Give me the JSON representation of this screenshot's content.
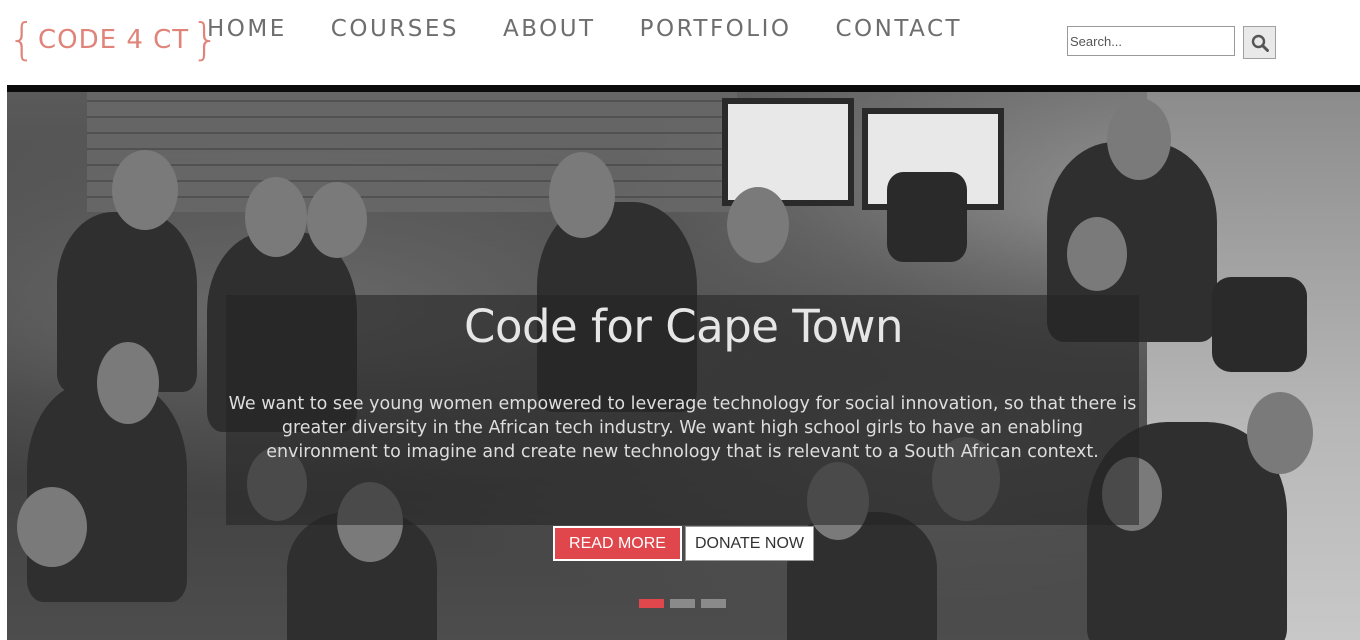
{
  "header": {
    "logo": {
      "text": "CODE 4 CT",
      "color": "#e0847a"
    },
    "nav": [
      "HOME",
      "COURSES",
      "ABOUT",
      "PORTFOLIO",
      "CONTACT"
    ],
    "search": {
      "placeholder": "Search...",
      "icon": "search-icon"
    }
  },
  "hero": {
    "title": "Code for Cape Town",
    "text": "We want to see young women empowered to leverage technology for social innovation, so that there is greater diversity in the African tech industry. We want high school girls to have an enabling environment to imagine and create new technology that is relevant to a South African context.",
    "read_more": "READ MORE",
    "donate": "DONATE NOW",
    "slides": {
      "count": 3,
      "active": 1
    },
    "accent": "#e0474d"
  }
}
